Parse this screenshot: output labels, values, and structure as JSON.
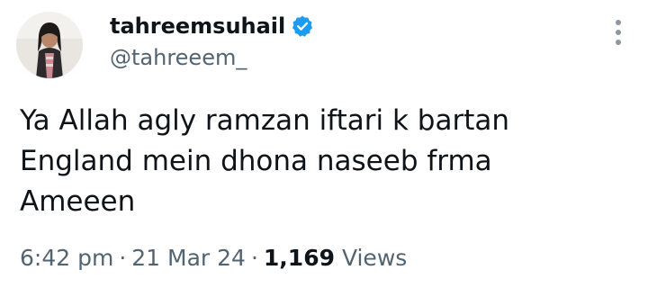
{
  "author": {
    "display_name": "tahreemsuhail",
    "handle": "@tahreeem_",
    "verified": true
  },
  "tweet": {
    "lines": [
      "Ya Allah agly ramzan iftari k bartan",
      "England mein dhona naseeb frma",
      "Ameeen"
    ]
  },
  "meta": {
    "time": "6:42 pm",
    "separator": "·",
    "date": "21 Mar 24",
    "views_count": "1,169",
    "views_label": "Views"
  },
  "icons": {
    "verified": "verified-badge-icon",
    "more": "more-options-icon"
  },
  "colors": {
    "text": "#0f1419",
    "secondary": "#536471",
    "verified_blue": "#1d9bf0"
  }
}
